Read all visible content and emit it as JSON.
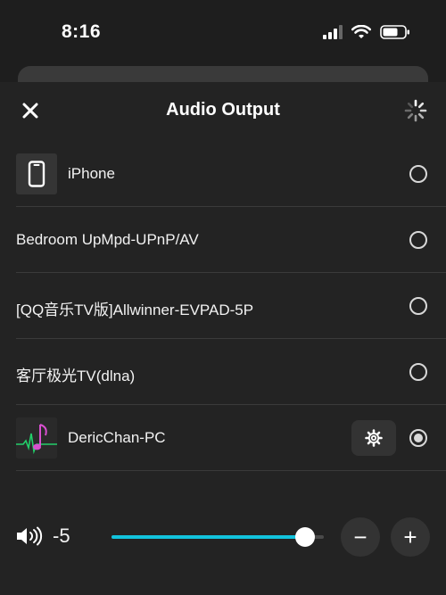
{
  "status": {
    "time": "8:16"
  },
  "header": {
    "title": "Audio Output"
  },
  "devices": [
    {
      "label": "iPhone",
      "thumb": "phone-icon",
      "selected": false,
      "settings": false
    },
    {
      "label": "Bedroom UpMpd-UPnP/AV",
      "thumb": null,
      "selected": false,
      "settings": false
    },
    {
      "label": "[QQ音乐TV版]Allwinner-EVPAD-5P",
      "thumb": null,
      "selected": false,
      "settings": false
    },
    {
      "label": "客厅极光TV(dlna)",
      "thumb": null,
      "selected": false,
      "settings": false
    },
    {
      "label": "DericChan-PC",
      "thumb": "music-note-art",
      "selected": true,
      "settings": true
    }
  ],
  "volume": {
    "value": "-5",
    "level": 0.91,
    "decrease_label": "−",
    "increase_label": "+"
  },
  "colors": {
    "accent": "#12c3dc",
    "background": "#1e1e1e",
    "sheet": "#232323"
  }
}
